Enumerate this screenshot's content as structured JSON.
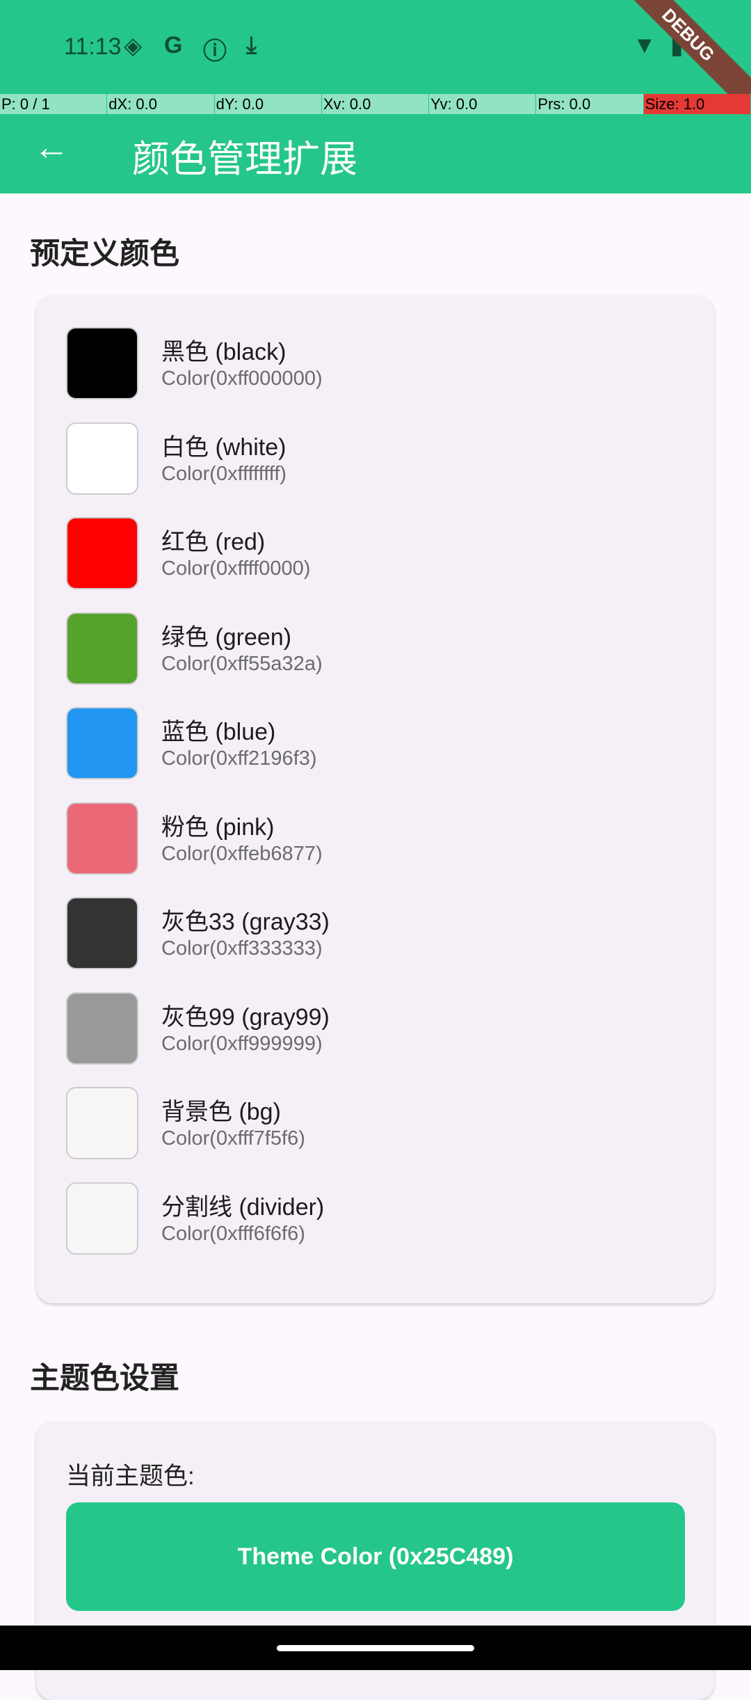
{
  "status": {
    "time": "11:13",
    "debug": "DEBUG"
  },
  "debug_bar": [
    "P: 0 / 1",
    "dX: 0.0",
    "dY: 0.0",
    "Xv: 0.0",
    "Yv: 0.0",
    "Prs: 0.0",
    "Size: 1.0"
  ],
  "appbar": {
    "title": "颜色管理扩展"
  },
  "section1": {
    "title": "预定义颜色"
  },
  "colors": [
    {
      "name": "黑色 (black)",
      "hex": "Color(0xff000000)",
      "color": "#000000"
    },
    {
      "name": "白色 (white)",
      "hex": "Color(0xffffffff)",
      "color": "#ffffff"
    },
    {
      "name": "红色 (red)",
      "hex": "Color(0xffff0000)",
      "color": "#ff0000"
    },
    {
      "name": "绿色 (green)",
      "hex": "Color(0xff55a32a)",
      "color": "#55a32a"
    },
    {
      "name": "蓝色 (blue)",
      "hex": "Color(0xff2196f3)",
      "color": "#2196f3"
    },
    {
      "name": "粉色 (pink)",
      "hex": "Color(0xffeb6877)",
      "color": "#eb6877"
    },
    {
      "name": "灰色33 (gray33)",
      "hex": "Color(0xff333333)",
      "color": "#333333"
    },
    {
      "name": "灰色99 (gray99)",
      "hex": "Color(0xff999999)",
      "color": "#999999"
    },
    {
      "name": "背景色 (bg)",
      "hex": "Color(0xfff7f5f6)",
      "color": "#f7f5f6"
    },
    {
      "name": "分割线 (divider)",
      "hex": "Color(0xfff6f6f6)",
      "color": "#f6f6f6"
    }
  ],
  "section2": {
    "title": "主题色设置",
    "current_label": "当前主题色:",
    "button": "Theme Color (0x25C489)",
    "theme_color": "#25c689"
  }
}
